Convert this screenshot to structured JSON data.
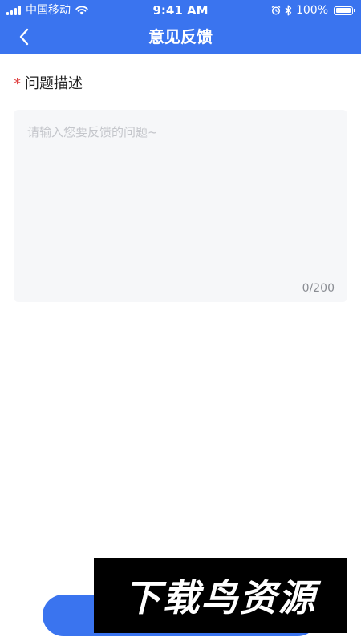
{
  "status_bar": {
    "carrier": "中国移动",
    "time": "9:41 AM",
    "battery": "100%"
  },
  "nav": {
    "title": "意见反馈"
  },
  "form": {
    "required_mark": "*",
    "label": "问题描述",
    "placeholder": "请输入您要反馈的问题~",
    "value": "",
    "counter": "0/200"
  },
  "watermark": {
    "text": "下载鸟资源"
  },
  "colors": {
    "primary": "#3a74ef",
    "required": "#e04545",
    "textarea_bg": "#f6f7f9"
  }
}
